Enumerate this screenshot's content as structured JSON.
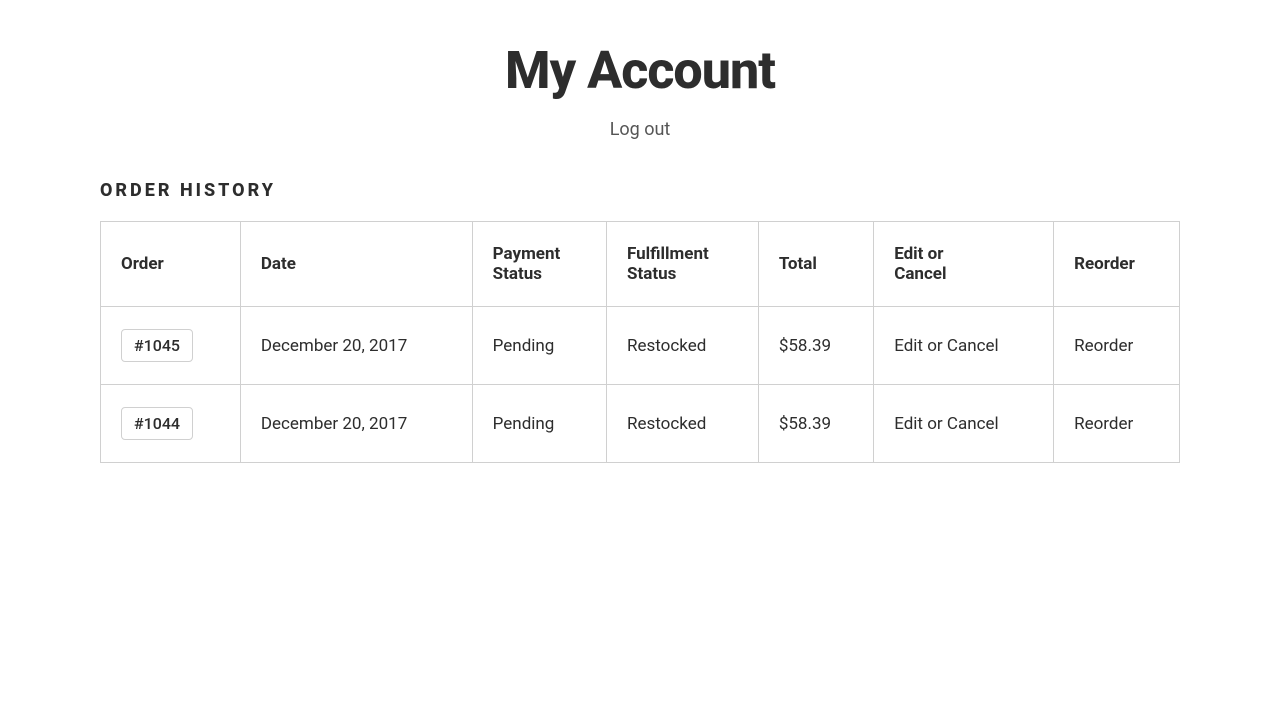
{
  "header": {
    "title": "My Account",
    "logout_label": "Log out"
  },
  "order_history": {
    "section_title": "ORDER HISTORY",
    "columns": [
      {
        "key": "order",
        "label": "Order"
      },
      {
        "key": "date",
        "label": "Date"
      },
      {
        "key": "payment_status",
        "label": "Payment Status"
      },
      {
        "key": "fulfillment_status",
        "label": "Fulfillment Status"
      },
      {
        "key": "total",
        "label": "Total"
      },
      {
        "key": "edit_or_cancel",
        "label": "Edit or Cancel"
      },
      {
        "key": "reorder",
        "label": "Reorder"
      }
    ],
    "rows": [
      {
        "order": "#1045",
        "date": "December 20, 2017",
        "payment_status": "Pending",
        "fulfillment_status": "Restocked",
        "total": "$58.39",
        "edit_or_cancel": "Edit or Cancel",
        "reorder": "Reorder"
      },
      {
        "order": "#1044",
        "date": "December 20, 2017",
        "payment_status": "Pending",
        "fulfillment_status": "Restocked",
        "total": "$58.39",
        "edit_or_cancel": "Edit or Cancel",
        "reorder": "Reorder"
      }
    ]
  }
}
